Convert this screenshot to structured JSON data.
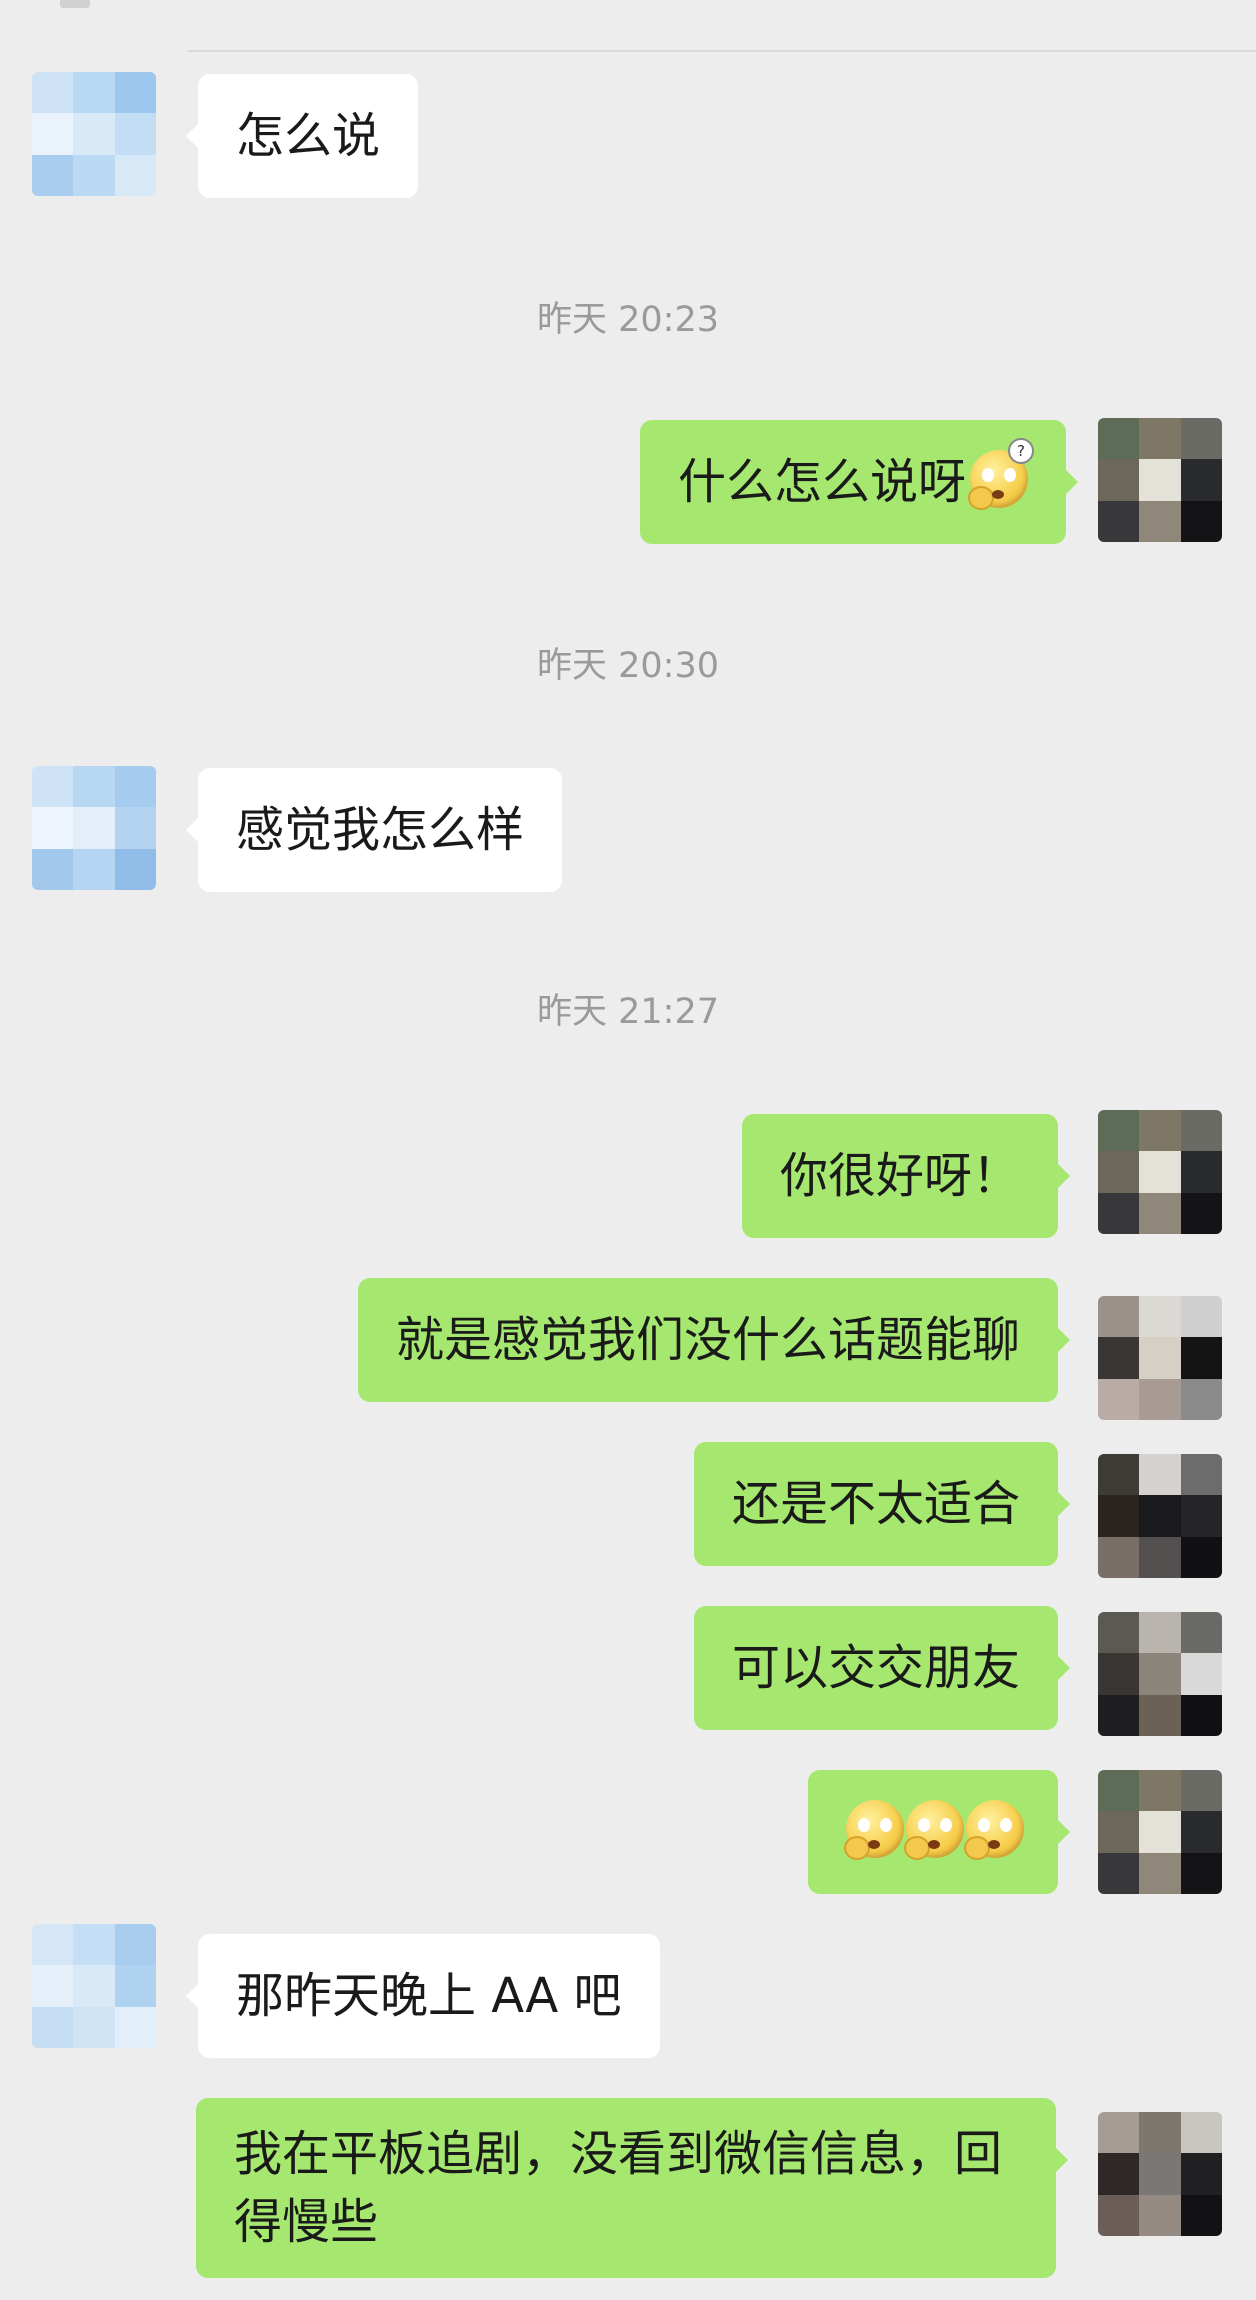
{
  "messages": [
    {
      "type": "incoming",
      "text": "怎么说"
    },
    {
      "type": "timestamp",
      "text": "昨天 20:23"
    },
    {
      "type": "outgoing",
      "text": "什么怎么说呀",
      "emoji": "face-with-question-emoji"
    },
    {
      "type": "timestamp",
      "text": "昨天 20:30"
    },
    {
      "type": "incoming",
      "text": "感觉我怎么样"
    },
    {
      "type": "timestamp",
      "text": "昨天 21:27"
    },
    {
      "type": "outgoing",
      "text": "你很好呀！"
    },
    {
      "type": "outgoing",
      "text": "就是感觉我们没什么话题能聊"
    },
    {
      "type": "outgoing",
      "text": "还是不太适合"
    },
    {
      "type": "outgoing",
      "text": "可以交交朋友"
    },
    {
      "type": "outgoing",
      "text": "",
      "emoji": "surprised-face-emoji",
      "emoji_count": 3
    },
    {
      "type": "incoming",
      "text": "那昨天晚上 AA 吧"
    },
    {
      "type": "outgoing",
      "text": "我在平板追剧，没看到微信信息，回得慢些"
    }
  ],
  "colors": {
    "background": "#ededed",
    "incoming_bubble": "#ffffff",
    "outgoing_bubble": "#a6e86f",
    "timestamp_text": "#9a9a9a"
  }
}
